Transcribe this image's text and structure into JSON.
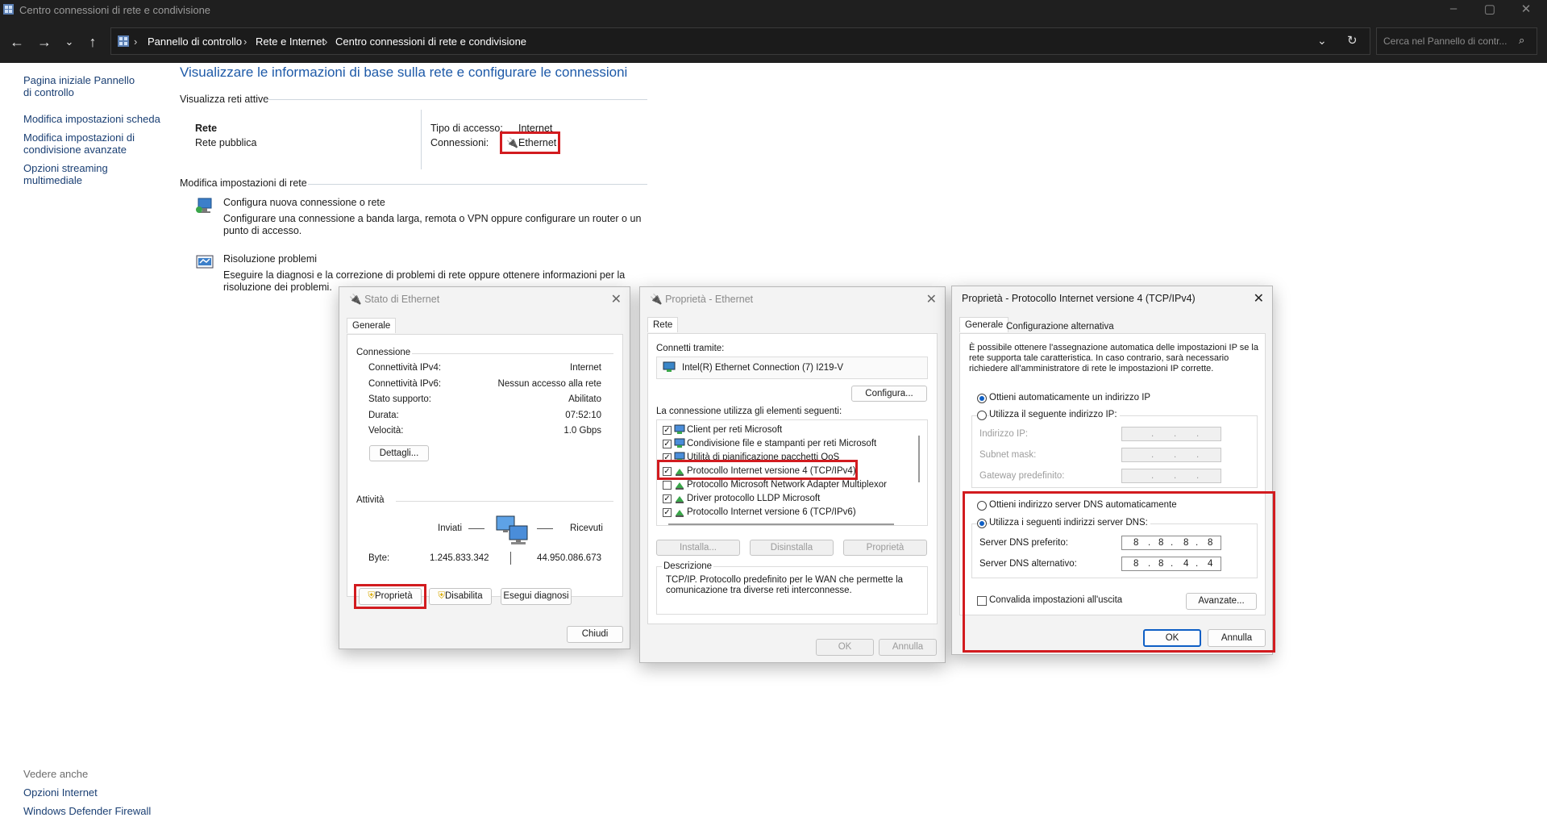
{
  "window": {
    "title": "Centro connessioni di rete e condivisione",
    "controls": {
      "minimize": "–",
      "maximize": "▢",
      "close": "✕"
    }
  },
  "address": {
    "crumbs": [
      "Pannello di controllo",
      "Rete e Internet",
      "Centro connessioni di rete e condivisione"
    ],
    "search_placeholder": "Cerca nel Pannello di contr..."
  },
  "sidebar": {
    "items": [
      "Pagina iniziale Pannello di controllo",
      "Modifica impostazioni scheda",
      "Modifica impostazioni di condivisione avanzate",
      "Opzioni streaming multimediale"
    ],
    "see_also_label": "Vedere anche",
    "see_also": [
      "Opzioni Internet",
      "Windows Defender Firewall"
    ]
  },
  "main": {
    "heading": "Visualizzare le informazioni di base sulla rete e configurare le connessioni",
    "active_networks_label": "Visualizza reti attive",
    "network_name": "Rete",
    "network_type": "Rete pubblica",
    "access_type_label": "Tipo di accesso:",
    "access_type_value": "Internet",
    "connections_label": "Connessioni:",
    "connections_value": "Ethernet",
    "change_settings_label": "Modifica impostazioni di rete",
    "new_connection_link": "Configura nuova connessione o rete",
    "new_connection_desc": "Configurare una connessione a banda larga, remota o VPN oppure configurare un router o un punto di accesso.",
    "troubleshoot_link": "Risoluzione problemi",
    "troubleshoot_desc": "Eseguire la diagnosi e la correzione di problemi di rete oppure ottenere informazioni per la risoluzione dei problemi."
  },
  "status_dialog": {
    "title": "Stato di Ethernet",
    "tab": "Generale",
    "connection_group": "Connessione",
    "rows": [
      {
        "label": "Connettività IPv4:",
        "value": "Internet"
      },
      {
        "label": "Connettività IPv6:",
        "value": "Nessun accesso alla rete"
      },
      {
        "label": "Stato supporto:",
        "value": "Abilitato"
      },
      {
        "label": "Durata:",
        "value": "07:52:10"
      },
      {
        "label": "Velocità:",
        "value": "1.0 Gbps"
      }
    ],
    "details_button": "Dettagli...",
    "activity_group": "Attività",
    "sent_label": "Inviati",
    "received_label": "Ricevuti",
    "bytes_label": "Byte:",
    "bytes_sent": "1.245.833.342",
    "bytes_received": "44.950.086.673",
    "properties_button": "Proprietà",
    "disable_button": "Disabilita",
    "diagnose_button": "Esegui diagnosi",
    "close_button": "Chiudi"
  },
  "properties_dialog": {
    "title": "Proprietà - Ethernet",
    "tab": "Rete",
    "connect_using_label": "Connetti tramite:",
    "adapter": "Intel(R) Ethernet Connection (7) I219-V",
    "configure_button": "Configura...",
    "items_label": "La connessione utilizza gli elementi seguenti:",
    "items": [
      {
        "label": "Client per reti Microsoft",
        "checked": true
      },
      {
        "label": "Condivisione file e stampanti per reti Microsoft",
        "checked": true
      },
      {
        "label": "Utilità di pianificazione pacchetti QoS",
        "checked": true
      },
      {
        "label": "Protocollo Internet versione 4 (TCP/IPv4)",
        "checked": true
      },
      {
        "label": "Protocollo Microsoft Network Adapter Multiplexor",
        "checked": false
      },
      {
        "label": "Driver protocollo LLDP Microsoft",
        "checked": true
      },
      {
        "label": "Protocollo Internet versione 6 (TCP/IPv6)",
        "checked": true
      }
    ],
    "install_button": "Installa...",
    "uninstall_button": "Disinstalla",
    "properties_button": "Proprietà",
    "description_group": "Descrizione",
    "description": "TCP/IP. Protocollo predefinito per le WAN che permette la comunicazione tra diverse reti interconnesse.",
    "ok_button": "OK",
    "cancel_button": "Annulla"
  },
  "ipv4_dialog": {
    "title": "Proprietà - Protocollo Internet versione 4 (TCP/IPv4)",
    "tab_general": "Generale",
    "tab_alternate": "Configurazione alternativa",
    "intro": "È possibile ottenere l'assegnazione automatica delle impostazioni IP se la rete supporta tale caratteristica. In caso contrario, sarà necessario richiedere all'amministratore di rete le impostazioni IP corrette.",
    "auto_ip": "Ottieni automaticamente un indirizzo IP",
    "manual_ip": "Utilizza il seguente indirizzo IP:",
    "ip_label": "Indirizzo IP:",
    "mask_label": "Subnet mask:",
    "gateway_label": "Gateway predefinito:",
    "auto_dns": "Ottieni indirizzo server DNS automaticamente",
    "manual_dns": "Utilizza i seguenti indirizzi server DNS:",
    "preferred_dns_label": "Server DNS preferito:",
    "preferred_dns": [
      "8",
      "8",
      "8",
      "8"
    ],
    "alternate_dns_label": "Server DNS alternativo:",
    "alternate_dns": [
      "8",
      "8",
      "4",
      "4"
    ],
    "validate_label": "Convalida impostazioni all'uscita",
    "advanced_button": "Avanzate...",
    "ok_button": "OK",
    "cancel_button": "Annulla"
  },
  "colors": {
    "highlight": "#d21b1f",
    "link": "#0a57c4",
    "titlebar": "#1f1f1f"
  }
}
